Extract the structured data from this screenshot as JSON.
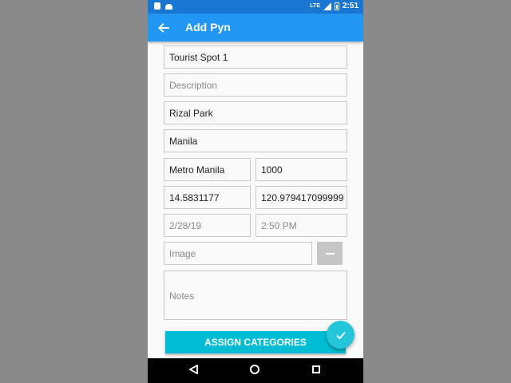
{
  "status_bar": {
    "time": "2:51",
    "signal_label": "LTE",
    "icons": [
      "sd-card-icon",
      "android-icon",
      "signal-icon",
      "battery-icon"
    ]
  },
  "app_bar": {
    "title": "Add Pyn",
    "back_icon": "arrow-back-icon",
    "background": "#2196f3"
  },
  "form": {
    "name": {
      "value": "Tourist Spot 1",
      "placeholder": ""
    },
    "description": {
      "value": "",
      "placeholder": "Description"
    },
    "address": {
      "value": "Rizal Park",
      "placeholder": ""
    },
    "city": {
      "value": "Manila",
      "placeholder": ""
    },
    "region": {
      "value": "Metro Manila",
      "placeholder": ""
    },
    "zip": {
      "value": "1000",
      "placeholder": ""
    },
    "latitude": {
      "value": "14.5831177",
      "placeholder": ""
    },
    "longitude": {
      "value": "120.979417099999",
      "placeholder": ""
    },
    "date": {
      "value": "2/28/19"
    },
    "time": {
      "value": "2:50 PM"
    },
    "image": {
      "value": "",
      "placeholder": "Image"
    },
    "notes": {
      "value": "",
      "placeholder": "Notes"
    }
  },
  "assign_categories_label": "ASSIGN CATEGORIES",
  "fab_icon": "check-icon",
  "nav_bar": {
    "icons": [
      "back-triangle-icon",
      "home-circle-icon",
      "recents-square-icon"
    ]
  },
  "colors": {
    "status_bar": "#1976d2",
    "accent": "#00bcd4",
    "fab": "#26c6da"
  }
}
